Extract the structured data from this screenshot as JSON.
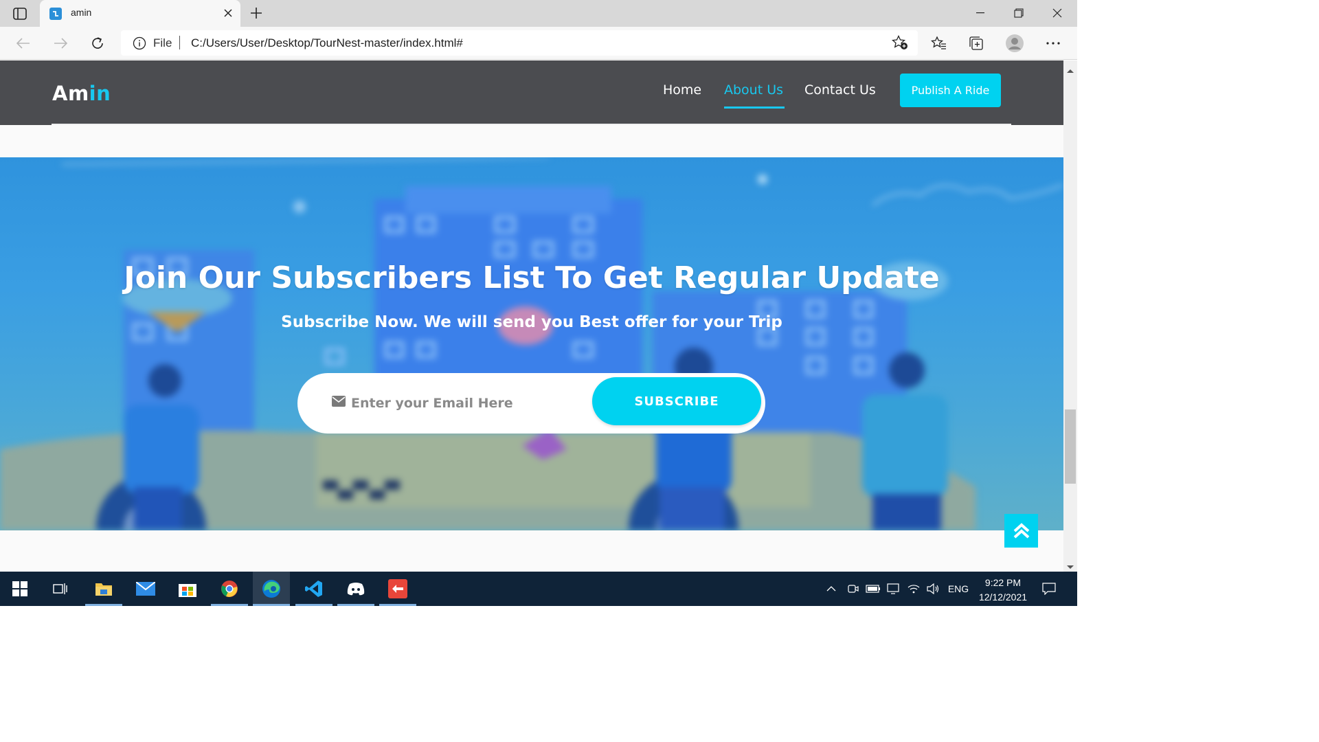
{
  "browser": {
    "tab_title": "amin",
    "address_prefix": "File",
    "url": "C:/Users/User/Desktop/TourNest-master/index.html#",
    "icons": [
      "sidebar-icon",
      "favicon",
      "close-icon",
      "plus-icon",
      "minimize-icon",
      "restore-icon",
      "window-close-icon",
      "back-icon",
      "forward-icon",
      "refresh-icon",
      "info-icon",
      "add-favorite-icon",
      "favorites-icon",
      "collections-icon",
      "profile-icon",
      "more-icon"
    ]
  },
  "site": {
    "logo_main": "Am",
    "logo_accent": "in",
    "accent_color": "#18c8ef",
    "nav": {
      "home": "Home",
      "about": "About Us",
      "contact": "Contact Us",
      "active": "About Us"
    },
    "publish_button": "Publish A Ride"
  },
  "subscribe": {
    "title": "Join Our Subscribers List To Get Regular Update",
    "subtitle": "Subscribe Now. We will send you Best offer for your Trip",
    "email_placeholder": "Enter your Email Here",
    "button": "SUBSCRIBE"
  },
  "taskbar": {
    "apps": [
      "start",
      "task-view",
      "file-explorer",
      "mail",
      "microsoft-store",
      "chrome",
      "edge",
      "vscode",
      "discord",
      "git-app"
    ],
    "language": "ENG",
    "time": "9:22 PM",
    "date": "12/12/2021"
  }
}
